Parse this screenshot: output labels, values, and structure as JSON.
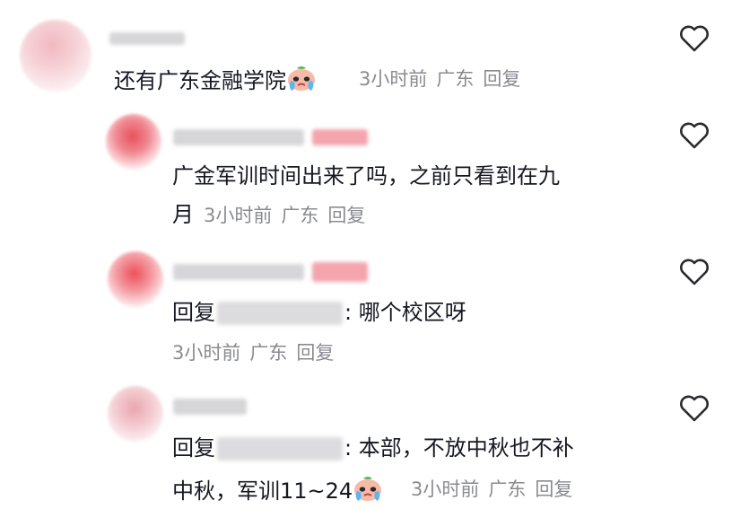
{
  "comments": [
    {
      "level": "top",
      "text_prefix": "还有广东金融学院",
      "emoji_icon": "crying-face-emoji",
      "time": "3小时前",
      "location": "广东",
      "reply": "回复",
      "like_icon": "heart-outline-icon"
    },
    {
      "level": "reply",
      "text_line1": "广金军训时间出来了吗，之前只看到在九",
      "text_line2": "月",
      "time": "3小时前",
      "location": "广东",
      "reply": "回复",
      "like_icon": "heart-outline-icon"
    },
    {
      "level": "reply",
      "reply_prefix": "回复",
      "reply_text": ": 哪个校区呀",
      "time": "3小时前",
      "location": "广东",
      "reply": "回复",
      "like_icon": "heart-outline-icon"
    },
    {
      "level": "reply",
      "reply_prefix": "回复",
      "reply_text": ": 本部，不放中秋也不补",
      "text_line2": "中秋，军训11~24",
      "emoji_icon": "crying-face-emoji",
      "time": "3小时前",
      "location": "广东",
      "reply": "回复",
      "like_icon": "heart-outline-icon"
    }
  ],
  "colors": {
    "text": "#161823",
    "meta": "#8a8b91",
    "heart": "#2b2b2f"
  }
}
